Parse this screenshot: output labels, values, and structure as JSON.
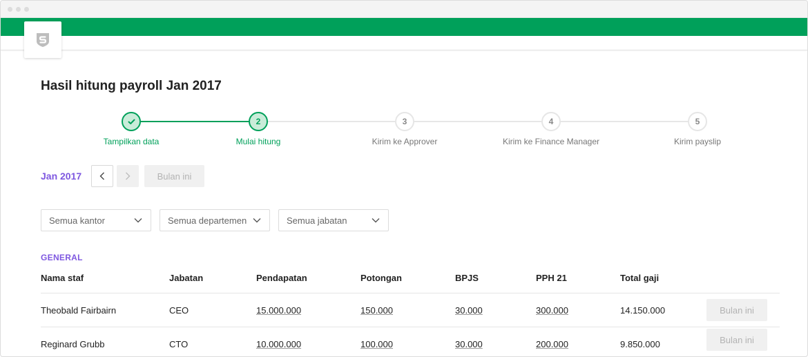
{
  "page": {
    "title": "Hasil hitung payroll Jan 2017"
  },
  "colors": {
    "brand_green": "#00a05a",
    "accent_purple": "#7e57e0"
  },
  "stepper": [
    {
      "label": "Tampilkan data",
      "badge": "",
      "state": "done"
    },
    {
      "label": "Mulai hitung",
      "badge": "2",
      "state": "active"
    },
    {
      "label": "Kirim ke Approver",
      "badge": "3",
      "state": "todo"
    },
    {
      "label": "Kirim ke Finance Manager",
      "badge": "4",
      "state": "todo"
    },
    {
      "label": "Kirim payslip",
      "badge": "5",
      "state": "todo"
    }
  ],
  "period": {
    "label": "Jan 2017",
    "current_month_button": "Bulan ini"
  },
  "filters": {
    "office": "Semua kantor",
    "department": "Semua departemen",
    "position": "Semua jabatan"
  },
  "section": {
    "label": "GENERAL"
  },
  "table": {
    "headers": {
      "name": "Nama staf",
      "position": "Jabatan",
      "income": "Pendapatan",
      "deduction": "Potongan",
      "bpjs": "BPJS",
      "pph21": "PPH 21",
      "total": "Total gaji"
    },
    "rows": [
      {
        "name": "Theobald Fairbairn",
        "position": "CEO",
        "income": "15.000.000",
        "deduction": "150.000",
        "bpjs": "30.000",
        "pph21": "300.000",
        "total": "14.150.000",
        "action": "Bulan ini"
      },
      {
        "name": "Reginard Grubb",
        "position": "CTO",
        "income": "10.000.000",
        "deduction": "100.000",
        "bpjs": "30.000",
        "pph21": "200.000",
        "total": "9.850.000",
        "action": "Bulan ini"
      }
    ]
  }
}
